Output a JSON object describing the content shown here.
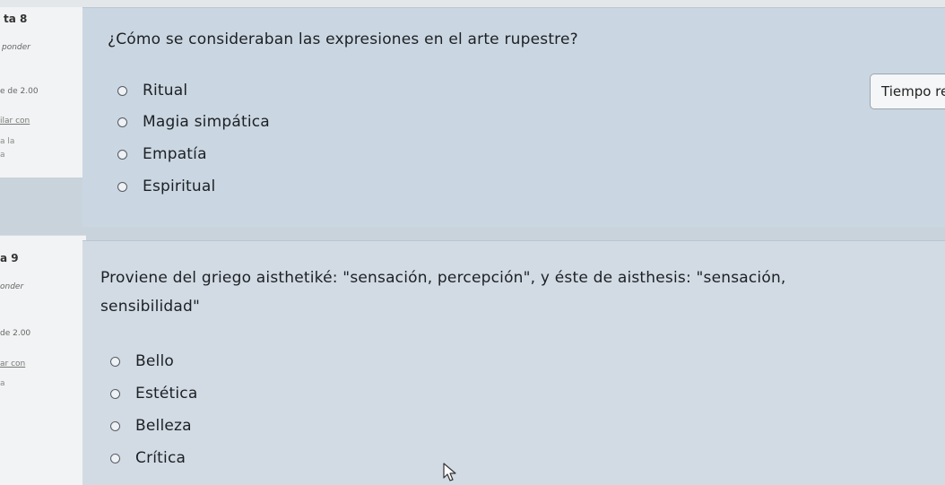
{
  "q8": {
    "sidebar": {
      "number": "ta 8",
      "sub": "ponder",
      "points": "e de 2.00",
      "link": "ilar con",
      "tail1": "a la",
      "tail2": "a"
    },
    "question": "¿Cómo se consideraban las expresiones en el arte rupestre?",
    "options": [
      "Ritual",
      "Magia simpática",
      "Empatía",
      "Espiritual"
    ]
  },
  "timer": {
    "label": "Tiempo re"
  },
  "q9": {
    "sidebar": {
      "number": "a 9",
      "sub": "onder",
      "points": "de 2.00",
      "link": "ar con",
      "tail1": "a"
    },
    "question_line1": "Proviene del griego aisthetiké: \"sensación, percepción\", y éste de aisthesis: \"sensación,",
    "question_line2": "sensibilidad\"",
    "options": [
      "Bello",
      "Estética",
      "Belleza",
      "Crítica"
    ]
  },
  "icons": {
    "cursor": "mouse-pointer-icon",
    "radio": "radio-unchecked-icon"
  },
  "colors": {
    "card_bg": "#cad6e1",
    "sidebar_bg": "#f2f3f4",
    "page_bg": "#c8d3dc"
  }
}
